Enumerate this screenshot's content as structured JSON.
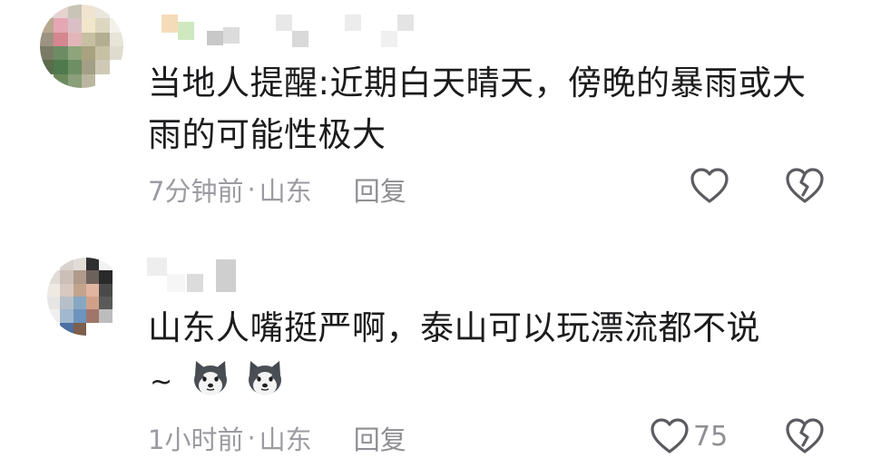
{
  "comments": [
    {
      "text": "当地人提醒:近期白天晴天，傍晚的暴雨或大雨的可能性极大",
      "time": "7分钟前",
      "separator": "·",
      "location": "山东",
      "reply_label": "回复",
      "like_count": ""
    },
    {
      "text": "山东人嘴挺严啊，泰山可以玩漂流都不说",
      "tilde": "~",
      "time": "1小时前",
      "separator": "·",
      "location": "山东",
      "reply_label": "回复",
      "like_count": "75"
    }
  ],
  "icons": {
    "like": "heart-outline-icon",
    "dislike": "broken-heart-icon",
    "emoji": "husky-dog-emoji"
  },
  "colors": {
    "text": "#1c1c1e",
    "meta": "#9b9ba1",
    "icon": "#5b5b60"
  }
}
